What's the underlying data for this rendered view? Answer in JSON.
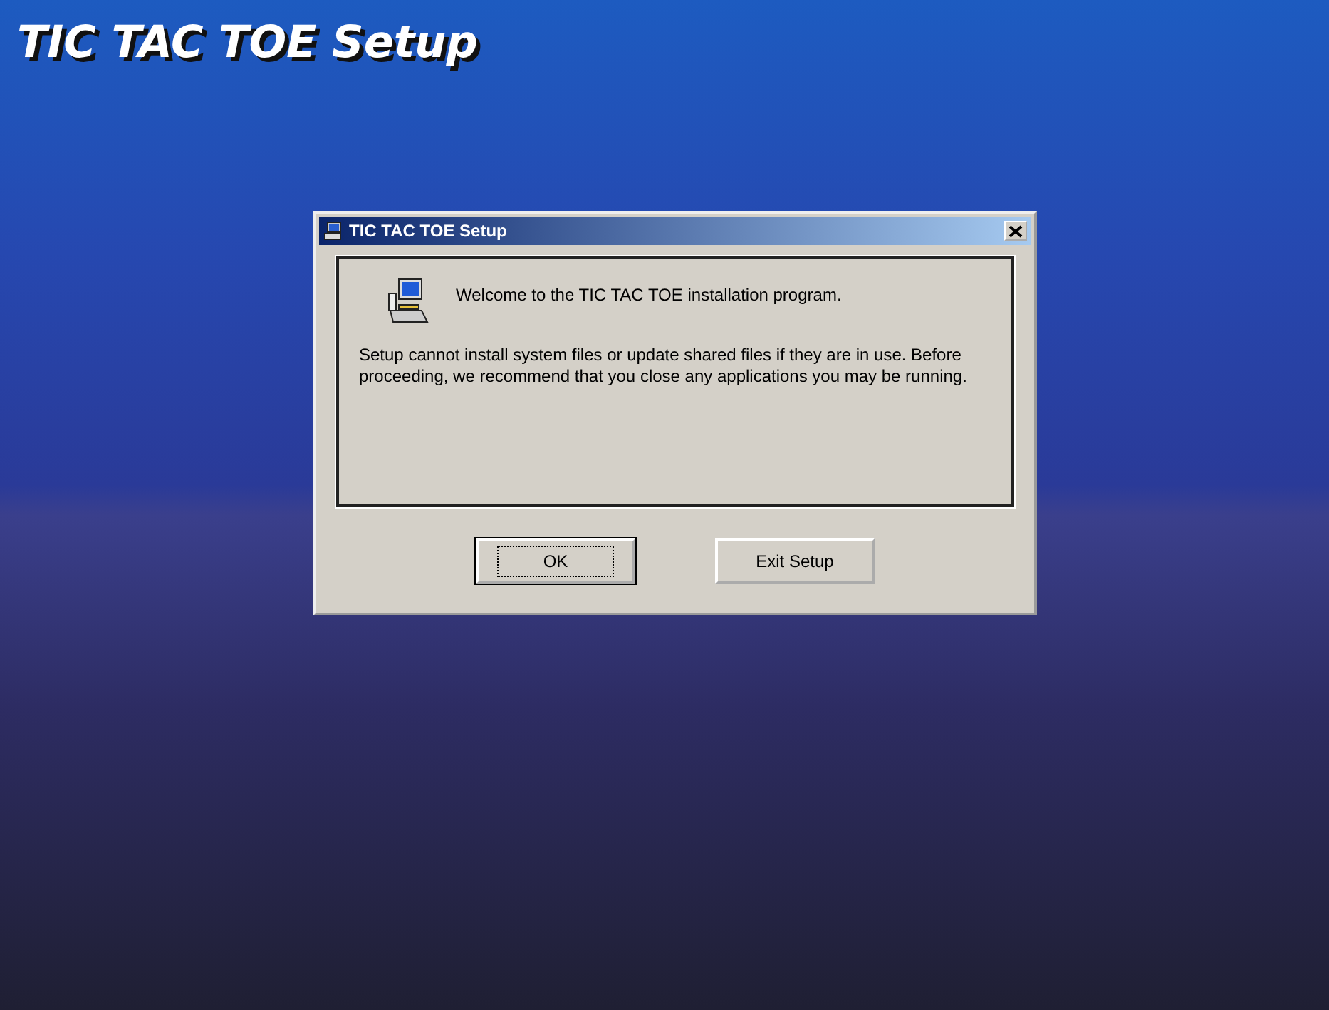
{
  "screen_title": "TIC TAC TOE Setup",
  "dialog": {
    "title": "TIC TAC TOE Setup",
    "heading": "Welcome to the TIC TAC TOE installation program.",
    "message": "Setup cannot install system files or update shared files if they are in use. Before proceeding, we recommend that you close any applications you may be running.",
    "buttons": [
      {
        "label": "OK",
        "default": true
      },
      {
        "label": "Exit Setup",
        "default": false
      }
    ]
  }
}
